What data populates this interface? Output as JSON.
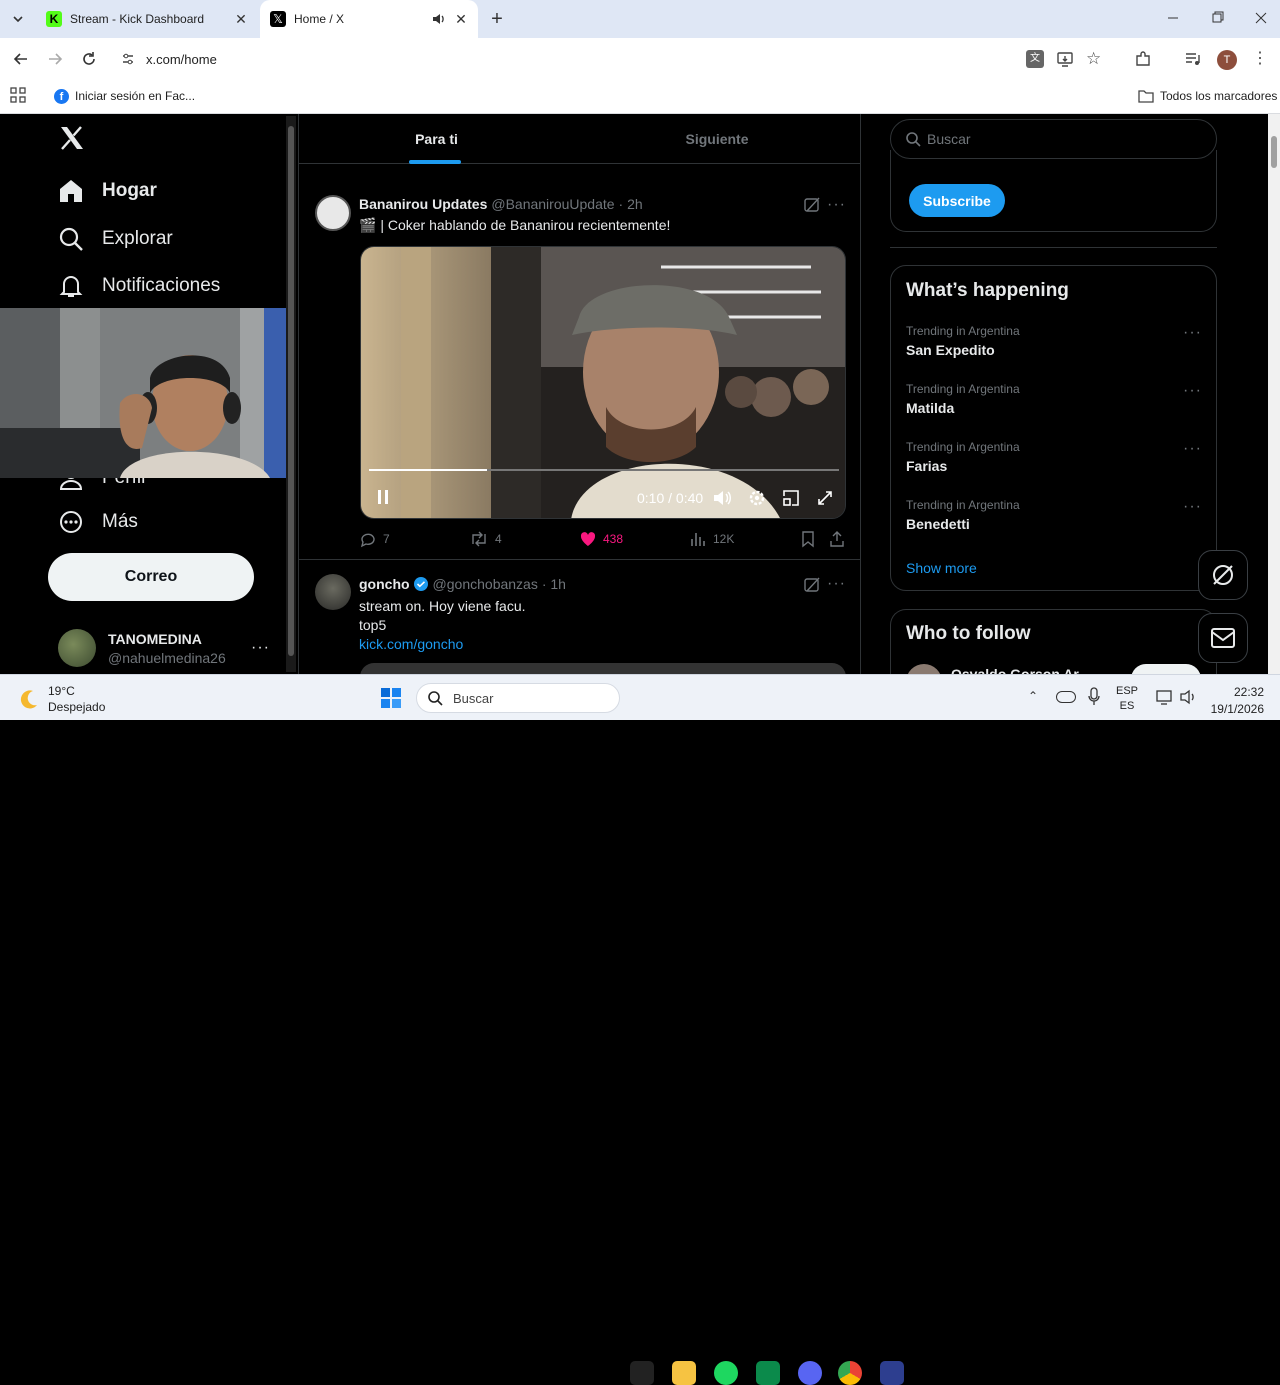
{
  "browser": {
    "tabs": [
      {
        "title": "Stream - Kick Dashboard",
        "active": false
      },
      {
        "title": "Home / X",
        "active": true
      }
    ],
    "url": "x.com/home",
    "bookmark": "Iniciar sesión en Fac...",
    "all_bookmarks": "Todos los marcadores",
    "profile_initial": "T"
  },
  "sidebar": {
    "logo": "X",
    "items": [
      {
        "label": "Hogar",
        "icon": "home-icon"
      },
      {
        "label": "Explorar",
        "icon": "search-icon"
      },
      {
        "label": "Notificaciones",
        "icon": "bell-icon"
      },
      {
        "label": "Perfil",
        "icon": "person-icon"
      },
      {
        "label": "Más",
        "icon": "more-circle-icon"
      }
    ],
    "post_button": "Correo",
    "account": {
      "name": "TANOMEDINA",
      "handle": "@nahuelmedina26"
    }
  },
  "timeline": {
    "tabs": [
      "Para ti",
      "Siguiente"
    ],
    "active_tab": "Para ti",
    "posts": [
      {
        "author": "Bananirou Updates",
        "handle": "@BananirouUpdate",
        "time": "· 2h",
        "text": "🎬 | Coker hablando de Bananirou recientemente!",
        "video": {
          "time": "0:10 / 0:40",
          "progress": 0.25
        },
        "replies": "7",
        "reposts": "4",
        "likes": "438",
        "views": "12K"
      },
      {
        "author": "goncho",
        "handle": "@gonchobanzas",
        "time": "· 1h",
        "verified": true,
        "lines": [
          "stream on. Hoy viene facu.",
          "top5"
        ],
        "link": "kick.com/goncho"
      }
    ]
  },
  "right": {
    "search_placeholder": "Buscar",
    "subscribe": "Subscribe",
    "happening_title": "What’s happening",
    "trends": [
      {
        "caption": "Trending in Argentina",
        "name": "San Expedito"
      },
      {
        "caption": "Trending in Argentina",
        "name": "Matilda"
      },
      {
        "caption": "Trending in Argentina",
        "name": "Farias"
      },
      {
        "caption": "Trending in Argentina",
        "name": "Benedetti"
      }
    ],
    "show_more": "Show more",
    "who_title": "Who to follow",
    "suggest_name": "Osvaldo Gorson Ar..."
  },
  "taskbar": {
    "weather_temp": "19°C",
    "weather_desc": "Despejado",
    "search": "Buscar",
    "lang1": "ESP",
    "lang2": "ES",
    "time": "22:32",
    "date": "19/1/2026"
  },
  "colors": {
    "accent": "#1d9bf0",
    "like": "#f91880",
    "bg": "#000000",
    "border": "#2f3336"
  }
}
